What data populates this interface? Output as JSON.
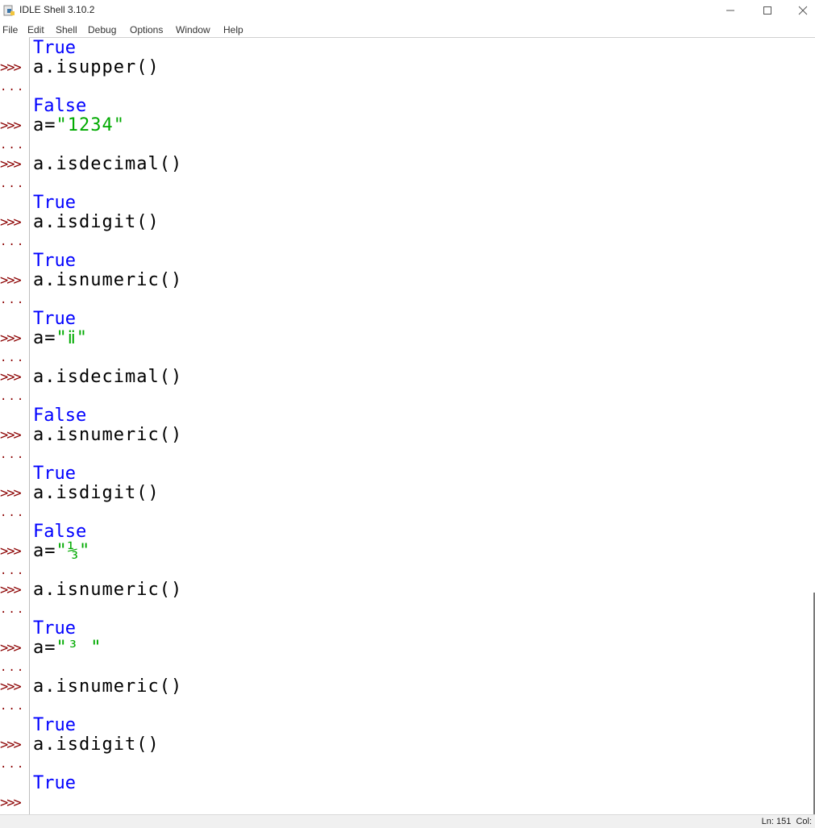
{
  "window": {
    "title": "IDLE Shell 3.10.2",
    "icons": {
      "app": "python-idle-icon",
      "minimize": "minimize-icon",
      "maximize": "maximize-icon",
      "close": "close-icon"
    }
  },
  "menu": {
    "file": "File",
    "edit": "Edit",
    "shell": "Shell",
    "debug": "Debug",
    "options": "Options",
    "window": "Window",
    "help": "Help"
  },
  "prompts": {
    "primary": ">>>",
    "continuation": "..."
  },
  "shell_lines": {
    "l01": "True",
    "l02": "a.isupper()",
    "l03": "False",
    "l04_pre": "a=",
    "l04_str": "\"1234\"",
    "l05": "a.isdecimal()",
    "l06": "True",
    "l07": "a.isdigit()",
    "l08": "True",
    "l09": "a.isnumeric()",
    "l10": "True",
    "l11_pre": "a=",
    "l11_str": "\"ⅱ\"",
    "l12": "a.isdecimal()",
    "l13": "False",
    "l14": "a.isnumeric()",
    "l15": "True",
    "l16": "a.isdigit()",
    "l17": "False",
    "l18_pre": "a=",
    "l18_str": "\"⅓\"",
    "l19": "a.isnumeric()",
    "l20": "True",
    "l21_pre": "a=",
    "l21_str": "\"³ \"",
    "l22": "a.isnumeric()",
    "l23": "True",
    "l24": "a.isdigit()",
    "l25": "True"
  },
  "status": {
    "text": "Ln: 151  Col:"
  },
  "colors": {
    "prompt": "#8b0000",
    "output": "#0000ff",
    "string": "#00aa00",
    "code": "#000000"
  }
}
